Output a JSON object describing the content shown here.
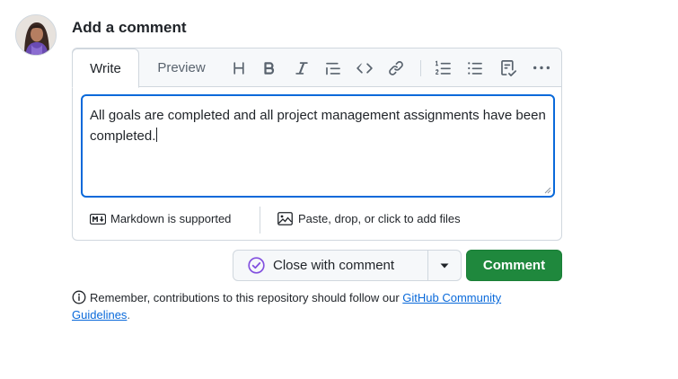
{
  "comment": {
    "heading": "Add a comment",
    "tabs": [
      {
        "label": "Write",
        "selected": true
      },
      {
        "label": "Preview",
        "selected": false
      }
    ],
    "toolbar_icons": [
      "heading-icon",
      "bold-icon",
      "italic-icon",
      "quote-icon",
      "code-icon",
      "link-icon",
      "ordered-list-icon",
      "unordered-list-icon",
      "task-list-icon",
      "more-options-icon"
    ],
    "body_text": "All goals are completed and all project management assignments have been completed.",
    "markdown_label": "Markdown is supported",
    "attach_label": "Paste, drop, or click to add files"
  },
  "actions": {
    "close_label": "Close with comment",
    "comment_label": "Comment"
  },
  "notice": {
    "text": "Remember, contributions to this repository should follow our ",
    "link_text": "GitHub Community Guidelines",
    "suffix": "."
  },
  "colors": {
    "accent": "#0969da",
    "primary_button": "#1f883d",
    "closed_purple": "#8250df"
  }
}
